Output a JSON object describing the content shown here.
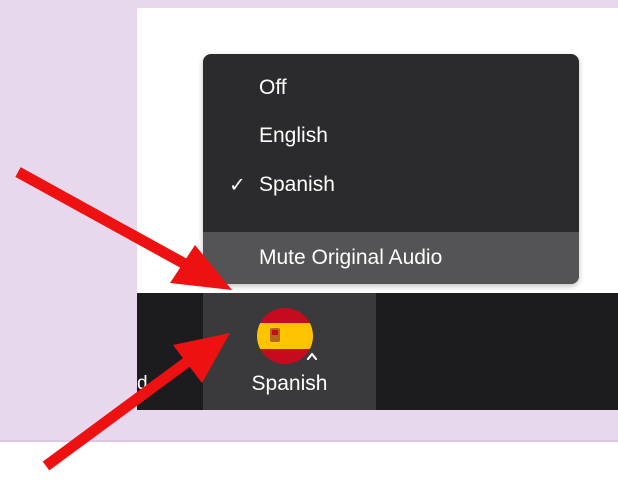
{
  "toolbar": {
    "left_label_fragment": "d",
    "language_button": {
      "label": "Spanish",
      "flag_icon": "spain-flag-icon",
      "caret_icon": "caret-up-icon"
    }
  },
  "menu": {
    "items": [
      {
        "label": "Off",
        "checked": false
      },
      {
        "label": "English",
        "checked": false
      },
      {
        "label": "Spanish",
        "checked": true,
        "check_glyph": "✓"
      }
    ],
    "action": {
      "label": "Mute Original Audio"
    }
  },
  "colors": {
    "background": "#e8d8ee",
    "toolbar": "#1c1c1e",
    "menu": "#2b2b2d",
    "highlight": "#545456",
    "arrow": "#ee1111"
  }
}
